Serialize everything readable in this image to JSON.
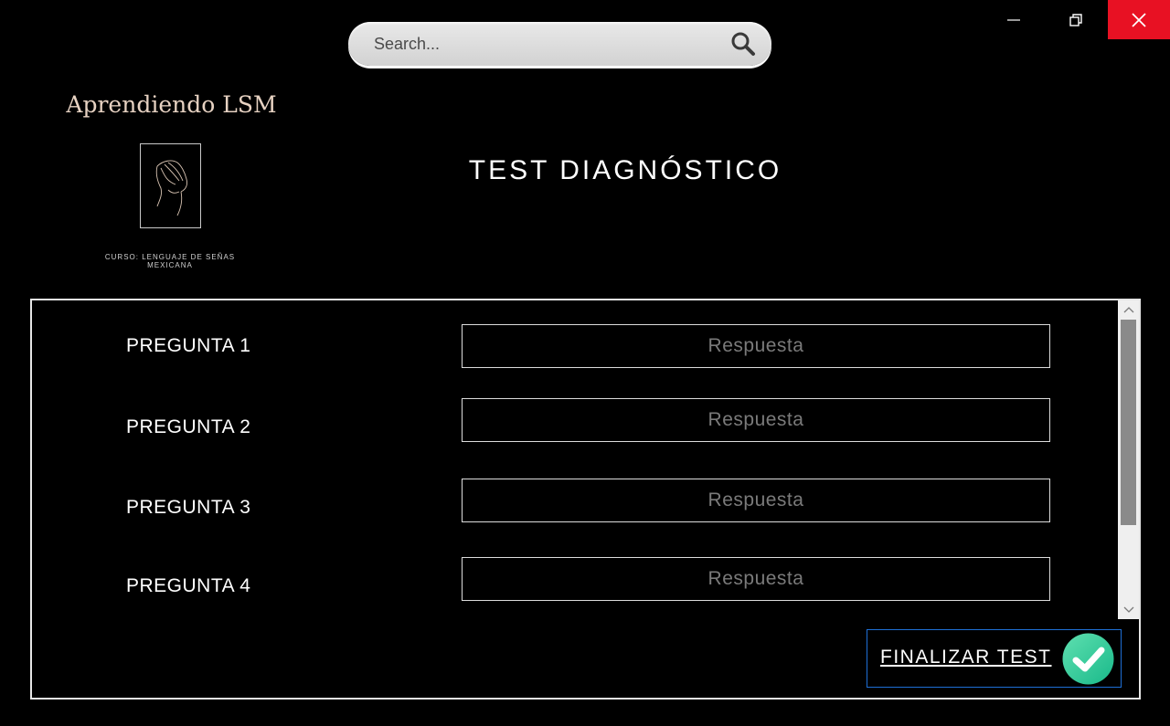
{
  "window": {
    "minimize_glyph": "minimize-icon",
    "maximize_glyph": "restore-icon",
    "close_glyph": "close-icon",
    "close_color": "#e81123"
  },
  "search": {
    "placeholder": "Search...",
    "icon": "search-icon"
  },
  "brand": {
    "title": "Aprendiendo LSM",
    "logo": "hand-sign-logo",
    "course_line1": "CURSO: LENGUAJE DE SEÑAS",
    "course_line2": "MEXICANA"
  },
  "page": {
    "title": "TEST DIAGNÓSTICO"
  },
  "questions": [
    {
      "label": "PREGUNTA 1",
      "placeholder": "Respuesta",
      "value": ""
    },
    {
      "label": "PREGUNTA 2",
      "placeholder": "Respuesta",
      "value": ""
    },
    {
      "label": "PREGUNTA 3",
      "placeholder": "Respuesta",
      "value": ""
    },
    {
      "label": "PREGUNTA 4",
      "placeholder": "Respuesta",
      "value": ""
    }
  ],
  "actions": {
    "finish_label": "FINALIZAR TEST",
    "finish_icon": "check-circle-icon",
    "finish_icon_color": "#2fd3a0"
  }
}
